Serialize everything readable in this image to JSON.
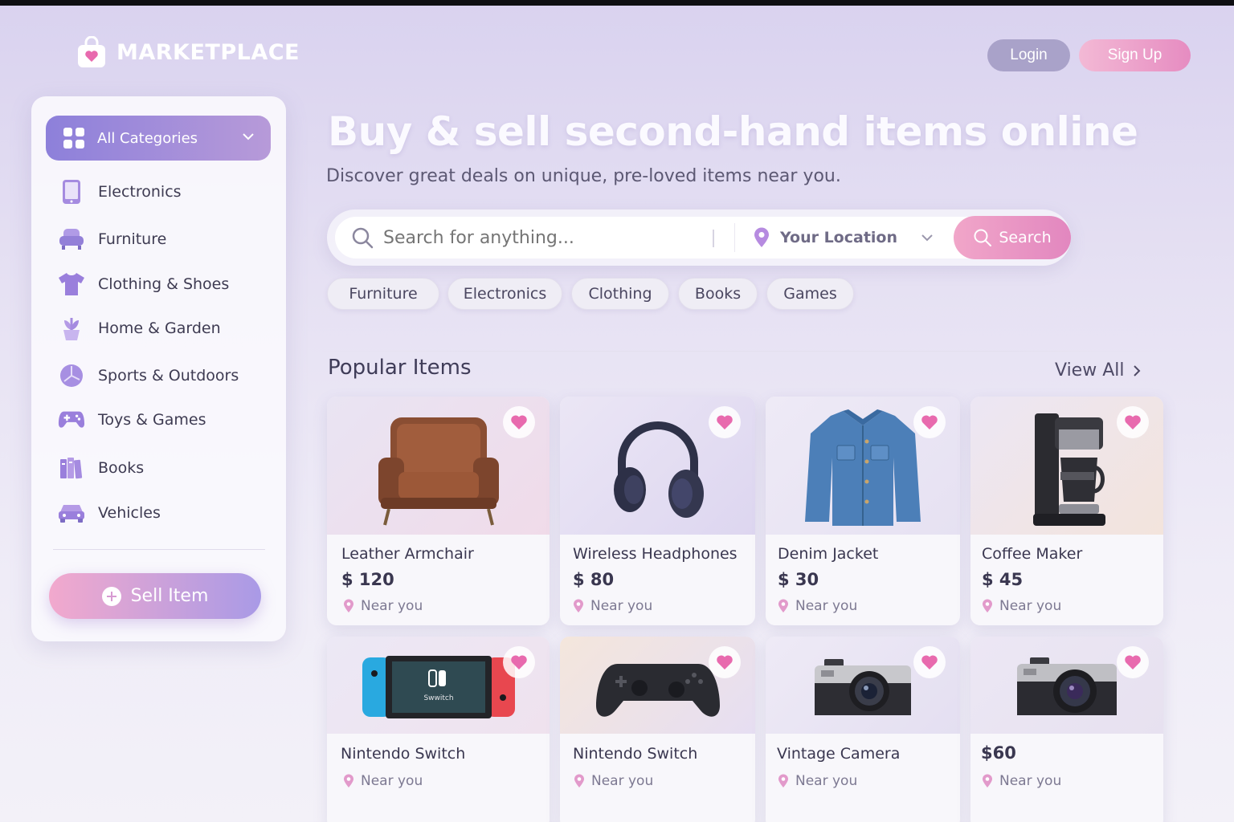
{
  "header": {
    "brand": "MARKETPLACE",
    "login_label": "Login",
    "signup_label": "Sign Up"
  },
  "sidebar": {
    "dropdown_label": "All Categories",
    "items": [
      {
        "label": "Electronics",
        "icon": "tablet-icon"
      },
      {
        "label": "Furniture",
        "icon": "armchair-icon"
      },
      {
        "label": "Clothing & Shoes",
        "icon": "shirt-icon"
      },
      {
        "label": "Home & Garden",
        "icon": "plant-icon"
      },
      {
        "label": "Sports & Outdoors",
        "icon": "ball-icon"
      },
      {
        "label": "Toys & Games",
        "icon": "gamepad-icon"
      },
      {
        "label": "Books",
        "icon": "books-icon"
      },
      {
        "label": "Vehicles",
        "icon": "car-icon"
      }
    ],
    "sell_label": "Sell Item"
  },
  "hero": {
    "title": "Buy & sell second-hand items online",
    "subtitle": "Discover great deals on unique, pre-loved items near you."
  },
  "search": {
    "placeholder": "Search for anything...",
    "location_label": "Your Location",
    "button_label": "Search"
  },
  "chips": [
    "Furniture",
    "Electronics",
    "Clothing",
    "Books",
    "Games"
  ],
  "popular": {
    "title": "Popular Items",
    "view_all": "View All",
    "items": [
      {
        "name": "Leather Armchair",
        "price": "$ 120",
        "location": "Near you",
        "image": "armchair"
      },
      {
        "name": "Wireless Headphones",
        "price": "$ 80",
        "location": "Near you",
        "image": "headphones"
      },
      {
        "name": "Denim Jacket",
        "price": "$ 30",
        "location": "Near you",
        "image": "jacket"
      },
      {
        "name": "Coffee Maker",
        "price": "$ 45",
        "location": "Near you",
        "image": "coffee-maker"
      },
      {
        "name": "Nintendo Switch",
        "price": "",
        "location": "Near you",
        "image": "switch",
        "image_text": "Swwitch"
      },
      {
        "name": "Nintendo Switch",
        "price": "",
        "location": "Near you",
        "image": "controller"
      },
      {
        "name": "Vintage Camera",
        "price": "",
        "location": "Near you",
        "image": "camera"
      },
      {
        "name": "",
        "price": "$60",
        "location": "Near you",
        "image": "camera-2"
      }
    ]
  },
  "colors": {
    "accent_purple": "#8d80da",
    "accent_pink": "#e68cc1",
    "heart": "#e86aae"
  }
}
